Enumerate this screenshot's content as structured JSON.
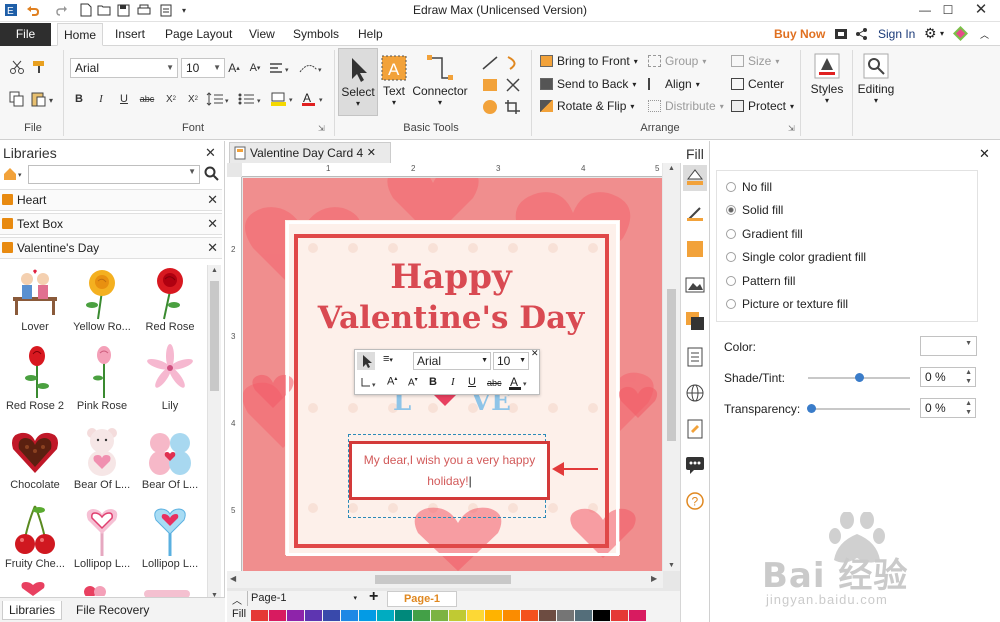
{
  "app": {
    "title": "Edraw Max (Unlicensed Version)",
    "buy_now": "Buy Now",
    "sign_in": "Sign In"
  },
  "ribbon_tabs": [
    "File",
    "Home",
    "Insert",
    "Page Layout",
    "View",
    "Symbols",
    "Help"
  ],
  "ribbon": {
    "font_name": "Arial",
    "font_size": "10",
    "groups": {
      "file": "File",
      "font": "Font",
      "basic_tools": "Basic Tools",
      "arrange": "Arrange"
    },
    "tools": {
      "select": "Select",
      "text": "Text",
      "connector": "Connector"
    },
    "arrange": {
      "bring_to_front": "Bring to Front",
      "send_to_back": "Send to Back",
      "rotate_flip": "Rotate & Flip",
      "group": "Group",
      "align": "Align",
      "distribute": "Distribute",
      "size": "Size",
      "center": "Center",
      "protect": "Protect"
    },
    "styles": "Styles",
    "editing": "Editing"
  },
  "libraries": {
    "title": "Libraries",
    "categories": [
      "Heart",
      "Text Box",
      "Valentine's Day"
    ],
    "items": [
      "Lover",
      "Yellow Ro...",
      "Red Rose",
      "Red Rose 2",
      "Pink Rose",
      "Lily",
      "Chocolate",
      "Bear Of L...",
      "Bear Of L...",
      "Fruity Che...",
      "Lollipop L...",
      "Lollipop L..."
    ],
    "bottom_tabs": [
      "Libraries",
      "File Recovery"
    ]
  },
  "document": {
    "tab": "Valentine Day Card 4",
    "card_line1": "Happy",
    "card_line2": "Valentine's Day",
    "message_line1": "My dear,I wish you a very happy",
    "message_line2": "holiday!",
    "float_font": "Arial",
    "float_size": "10",
    "ruler_h": [
      "1",
      "2",
      "3",
      "4",
      "5"
    ],
    "ruler_v": [
      "2",
      "3",
      "4",
      "5"
    ]
  },
  "pages": {
    "selector": "Page-1",
    "active": "Page-1",
    "fill_label": "Fill"
  },
  "fill_panel": {
    "title": "Fill",
    "options": [
      {
        "label": "No fill",
        "selected": false
      },
      {
        "label": "Solid fill",
        "selected": true
      },
      {
        "label": "Gradient fill",
        "selected": false
      },
      {
        "label": "Single color gradient fill",
        "selected": false
      },
      {
        "label": "Pattern fill",
        "selected": false
      },
      {
        "label": "Picture or texture fill",
        "selected": false
      }
    ],
    "color_label": "Color:",
    "shade_label": "Shade/Tint:",
    "shade_value": "0 %",
    "shade_level": 0.5,
    "transparency_label": "Transparency:",
    "transparency_value": "0 %",
    "transparency_level": 0
  },
  "watermark": {
    "text": "Bai 经验",
    "url": "jingyan.baidu.com"
  },
  "palette": [
    "#e53935",
    "#d81b60",
    "#8e24aa",
    "#5e35b1",
    "#3949ab",
    "#1e88e5",
    "#039be5",
    "#00acc1",
    "#00897b",
    "#43a047",
    "#7cb342",
    "#c0ca33",
    "#fdd835",
    "#ffb300",
    "#fb8c00",
    "#f4511e",
    "#6d4c41",
    "#757575",
    "#546e7a",
    "#000000"
  ],
  "colors": {
    "accent_orange": "#e07020",
    "card_pink": "#f08e8e",
    "title_red": "#d94a52",
    "textbox_border": "#d33a3a"
  }
}
